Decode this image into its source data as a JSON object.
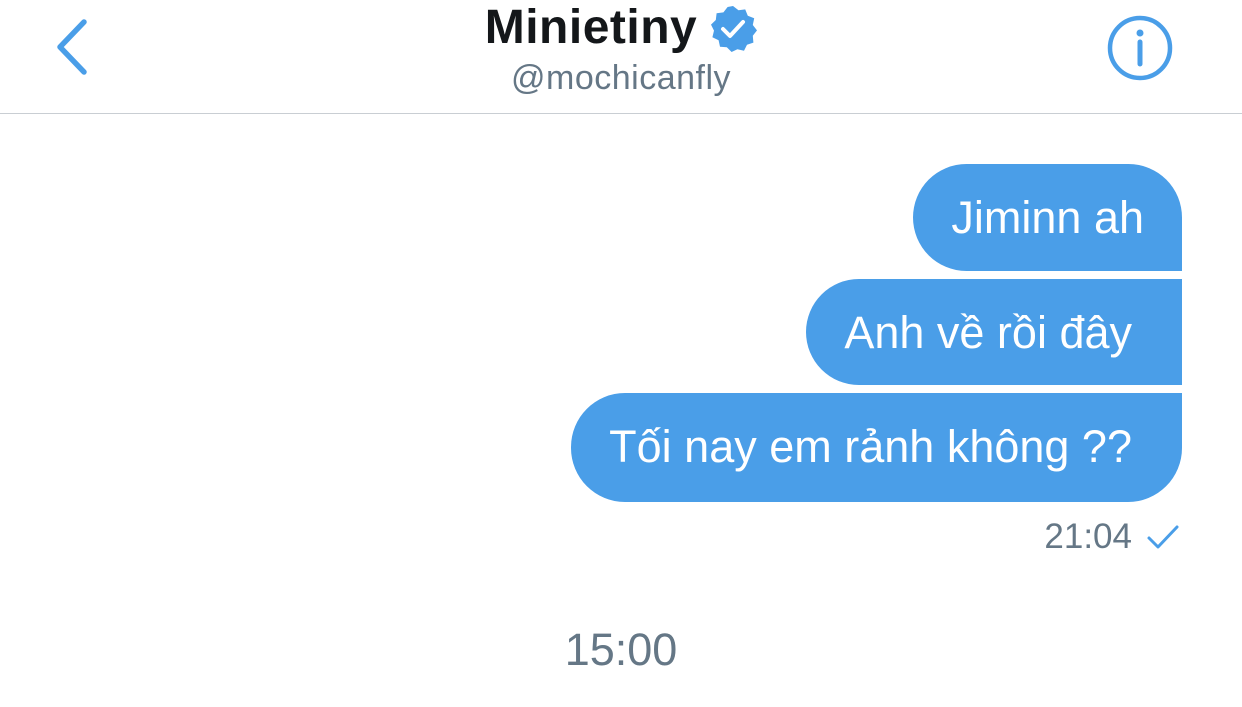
{
  "header": {
    "title": "Minietiny",
    "handle": "@mochicanfly",
    "icons": {
      "back": "chevron-left-icon",
      "verified": "verified-badge-icon",
      "info": "info-icon"
    }
  },
  "messages": [
    {
      "text": "Jiminn ah"
    },
    {
      "text": "Anh về rồi đây"
    },
    {
      "text": "Tối nay em rảnh không ??"
    }
  ],
  "message_meta": {
    "time": "21:04",
    "status_icon": "checkmark-icon"
  },
  "time_divider": "15:00",
  "colors": {
    "accent": "#4a9ee8",
    "title_text": "#14171a",
    "secondary_text": "#657786",
    "divider": "#c9ced3"
  }
}
